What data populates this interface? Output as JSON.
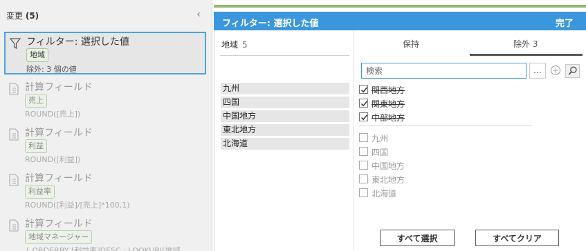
{
  "changes_panel": {
    "title": "変更",
    "count": "(5)",
    "items": [
      {
        "title": "フィルター: 選択した値",
        "field": "地域",
        "desc": "除外: 3 個の値"
      },
      {
        "title": "計算フィールド",
        "field": "売上",
        "desc": "ROUND([売上])"
      },
      {
        "title": "計算フィールド",
        "field": "利益",
        "desc": "ROUND([利益])"
      },
      {
        "title": "計算フィールド",
        "field": "利益率",
        "desc": "ROUND([利益]/[売上]*100,1)"
      },
      {
        "title": "計算フィールド",
        "field": "地域マネージャー",
        "desc": "{ ORDERBY [利益率]DESC : LOOKUP([地域"
      }
    ]
  },
  "filter_panel": {
    "title": "フィルター: 選択した値",
    "done_label": "完了",
    "field_name": "地域",
    "field_count": "5",
    "values": [
      "九州",
      "四国",
      "中国地方",
      "東北地方",
      "北海道"
    ],
    "tabs": {
      "keep": "保持",
      "exclude": "除外 3",
      "active": "exclude"
    },
    "search": {
      "placeholder": "検索",
      "value": ""
    },
    "more_label": "…",
    "excluded_items": [
      "関西地方",
      "関東地方",
      "中部地方"
    ],
    "other_items": [
      "九州",
      "四国",
      "中国地方",
      "東北地方",
      "北海道"
    ],
    "select_all_label": "すべて選択",
    "clear_all_label": "すべてクリア"
  },
  "colors": {
    "header_blue": "#3b97dd",
    "top_bar_green": "#95b773",
    "selection_outline": "#4aa3df"
  }
}
